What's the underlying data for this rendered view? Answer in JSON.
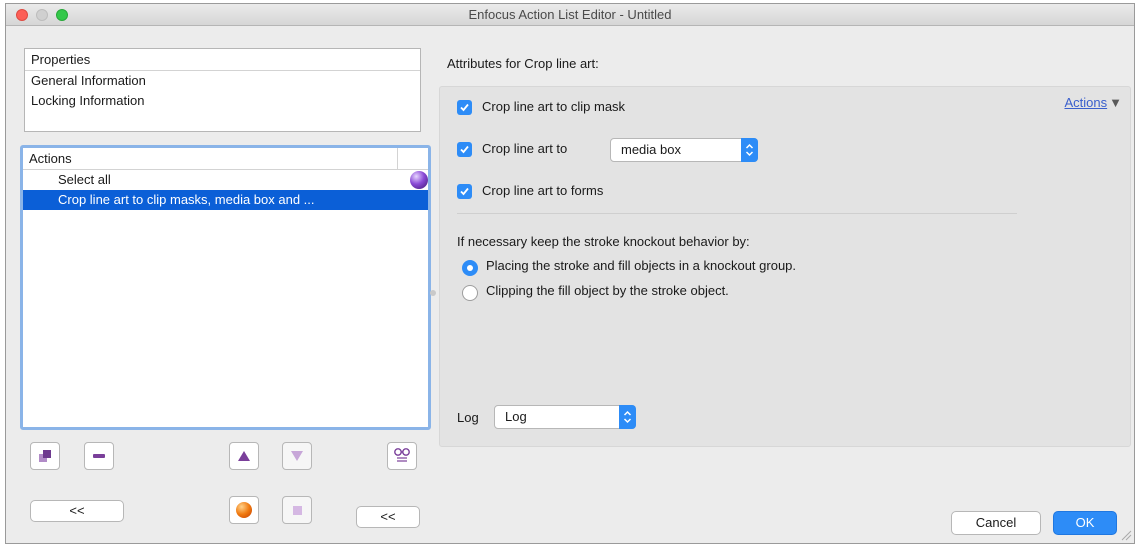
{
  "window": {
    "title": "Enfocus Action List Editor - Untitled"
  },
  "properties": {
    "header": "Properties",
    "items": [
      "General Information",
      "Locking Information"
    ]
  },
  "actions_list": {
    "header": "Actions",
    "items": [
      {
        "label": "Select all",
        "selected": false
      },
      {
        "label": "Crop line art to clip masks, media box and ...",
        "selected": true
      }
    ]
  },
  "toolbar": {
    "collapse_left_label": "<<",
    "collapse_right_label": "<<"
  },
  "attributes": {
    "title": "Attributes for Crop line art:",
    "actions_menu_label": "Actions",
    "options": [
      {
        "label": "Crop line art to clip mask",
        "checked": true
      },
      {
        "label": "Crop line art to",
        "checked": true
      },
      {
        "label": "Crop line art to forms",
        "checked": true
      }
    ],
    "crop_target_select": {
      "value": "media box"
    },
    "knockout_prompt": "If necessary keep the stroke knockout behavior by:",
    "knockout_options": [
      {
        "label": "Placing the stroke and fill objects in a knockout group.",
        "selected": true
      },
      {
        "label": "Clipping the fill object by the stroke object.",
        "selected": false
      }
    ],
    "log_label": "Log",
    "log_select": {
      "value": "Log"
    }
  },
  "dialog": {
    "cancel_label": "Cancel",
    "ok_label": "OK"
  },
  "colors": {
    "accent": "#2d8cf7",
    "selection": "#0b5fd7",
    "link": "#3a5fcd"
  }
}
